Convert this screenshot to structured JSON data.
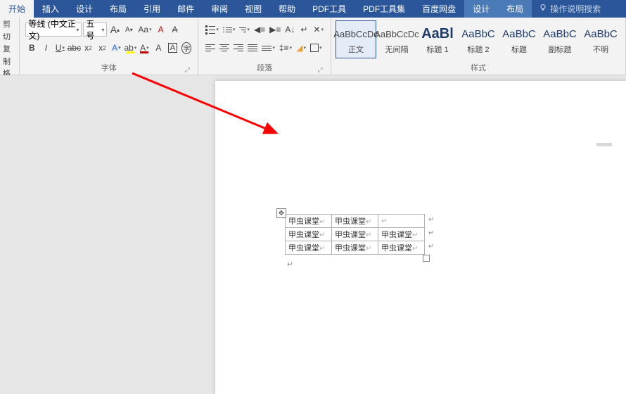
{
  "tabs": {
    "home": "开始",
    "insert": "插入",
    "design": "设计",
    "layout": "布局",
    "reference": "引用",
    "mail": "邮件",
    "review": "审阅",
    "view": "视图",
    "help": "帮助",
    "pdftools": "PDF工具",
    "pdftoolset": "PDF工具集",
    "baidudisk": "百度网盘",
    "table_design": "设计",
    "table_layout": "布局",
    "search_hint": "操作说明搜索"
  },
  "clipboard": {
    "cut": "剪切",
    "copy": "复制",
    "format_painter": "格式刷"
  },
  "font": {
    "name": "等线 (中文正文)",
    "size": "五号",
    "increase": "A",
    "decrease": "A",
    "change_case": "Aa",
    "phonetic": "A",
    "clear": "A",
    "bold": "B",
    "italic": "I",
    "underline": "U",
    "strike": "abc",
    "subscript_x": "x",
    "superscript_x": "x",
    "text_effects": "A",
    "highlight": "ab",
    "font_color": "A",
    "char_shading": "A",
    "char_border": "A",
    "circle_char": "字",
    "group_label": "字体"
  },
  "paragraph": {
    "group_label": "段落"
  },
  "styles": {
    "group_label": "样式",
    "items": [
      {
        "preview": "AaBbCcDc",
        "name": "正文"
      },
      {
        "preview": "AaBbCcDc",
        "name": "无间隔"
      },
      {
        "preview": "AaBl",
        "name": "标题 1"
      },
      {
        "preview": "AaBbC",
        "name": "标题 2"
      },
      {
        "preview": "AaBbC",
        "name": "标题"
      },
      {
        "preview": "AaBbC",
        "name": "副标题"
      },
      {
        "preview": "AaBbC",
        "name": "不明"
      }
    ]
  },
  "table": {
    "cell": "甲虫课堂",
    "rows": [
      [
        true,
        true,
        false
      ],
      [
        true,
        true,
        true
      ],
      [
        true,
        true,
        true
      ]
    ]
  }
}
